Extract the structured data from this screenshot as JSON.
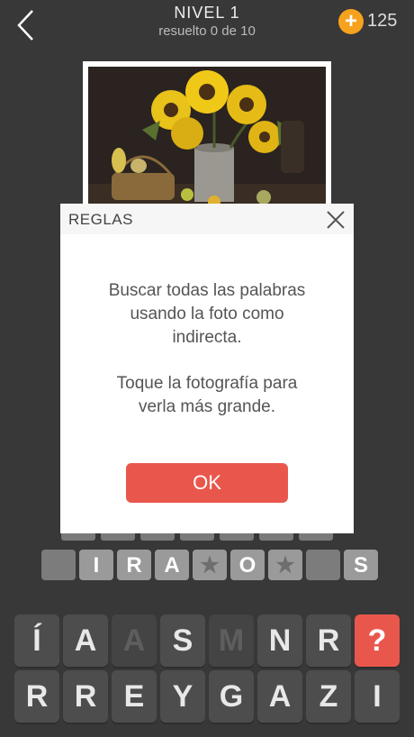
{
  "header": {
    "title": "NIVEL 1",
    "subtitle": "resuelto 0 de 10",
    "coin_symbol": "+",
    "coins": "125"
  },
  "answer_slots": [
    "",
    "I",
    "R",
    "A",
    "★",
    "O",
    "★",
    "",
    "S"
  ],
  "keyboard": {
    "row1": [
      {
        "letter": "Í",
        "state": "normal"
      },
      {
        "letter": "A",
        "state": "normal"
      },
      {
        "letter": "A",
        "state": "used"
      },
      {
        "letter": "S",
        "state": "normal"
      },
      {
        "letter": "M",
        "state": "used"
      },
      {
        "letter": "N",
        "state": "normal"
      },
      {
        "letter": "R",
        "state": "normal"
      },
      {
        "letter": "?",
        "state": "hint"
      }
    ],
    "row2": [
      {
        "letter": "R",
        "state": "normal"
      },
      {
        "letter": "R",
        "state": "normal"
      },
      {
        "letter": "E",
        "state": "normal"
      },
      {
        "letter": "Y",
        "state": "normal"
      },
      {
        "letter": "G",
        "state": "normal"
      },
      {
        "letter": "A",
        "state": "normal"
      },
      {
        "letter": "Z",
        "state": "normal"
      },
      {
        "letter": "I",
        "state": "normal"
      }
    ]
  },
  "modal": {
    "title": "REGLAS",
    "line1": "Buscar todas las palabras",
    "line2": "usando la foto como",
    "line3": "indirecta.",
    "line4": "Toque la fotografía para",
    "line5": "verla más grande.",
    "ok_label": "OK"
  },
  "colors": {
    "accent": "#e9574c",
    "coin": "#f6a21e",
    "background": "#383838"
  },
  "icons": {
    "back": "chevron-left-icon",
    "coin": "plus-coin-icon",
    "close": "close-icon"
  }
}
